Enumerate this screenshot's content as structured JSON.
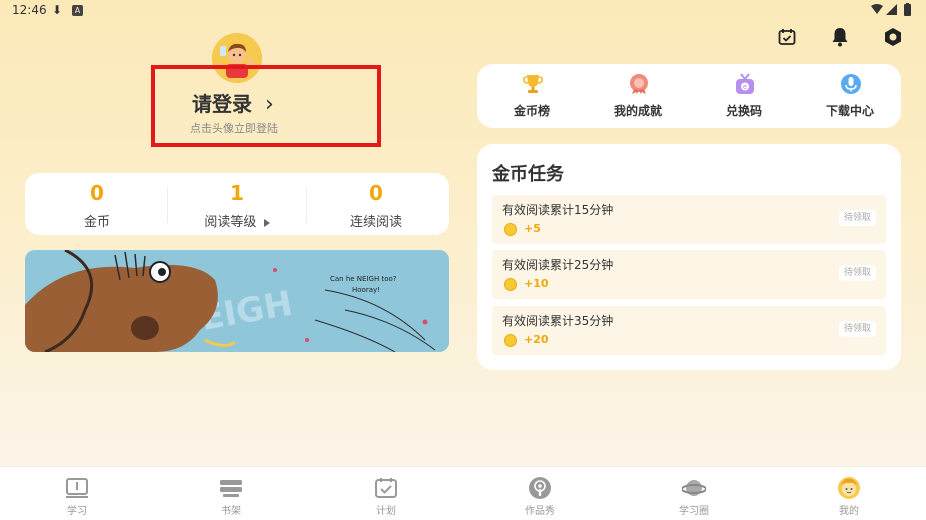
{
  "status_bar": {
    "time": "12:46",
    "download_glyph": "⬇",
    "a_badge": "A",
    "right_glyphs": "▾◢▮"
  },
  "top_icons": [
    {
      "name": "calendar-check-icon"
    },
    {
      "name": "bell-icon"
    },
    {
      "name": "settings-hex-icon"
    }
  ],
  "profile": {
    "login_title": "请登录",
    "chevron": "›",
    "login_subtitle": "点击头像立即登陆"
  },
  "stats": [
    {
      "value": "0",
      "label": "金币"
    },
    {
      "value": "1",
      "label": "阅读等级"
    },
    {
      "value": "0",
      "label": "连续阅读"
    }
  ],
  "banner": {
    "line1": "Can he NEIGH too?",
    "line2": "Hooray!",
    "big_text": "NEIGH"
  },
  "quick_links": [
    {
      "label": "金币榜",
      "icon": "trophy-icon"
    },
    {
      "label": "我的成就",
      "icon": "medal-icon"
    },
    {
      "label": "兑换码",
      "icon": "gift-code-icon"
    },
    {
      "label": "下载中心",
      "icon": "download-center-icon"
    }
  ],
  "tasks": {
    "title": "金币任务",
    "items": [
      {
        "name": "有效阅读累计15分钟",
        "reward": "+5",
        "button": "待领取"
      },
      {
        "name": "有效阅读累计25分钟",
        "reward": "+10",
        "button": "待领取"
      },
      {
        "name": "有效阅读累计35分钟",
        "reward": "+20",
        "button": "待领取"
      }
    ]
  },
  "bottom_nav": [
    {
      "label": "学习",
      "icon": "book-icon"
    },
    {
      "label": "书架",
      "icon": "bookshelf-icon"
    },
    {
      "label": "计划",
      "icon": "plan-calendar-icon"
    },
    {
      "label": "作品秀",
      "icon": "podcast-icon"
    },
    {
      "label": "学习圈",
      "icon": "planet-icon"
    },
    {
      "label": "我的",
      "icon": "profile-face-icon",
      "active": true
    }
  ],
  "colors": {
    "accent": "#f2a60e",
    "highlight_box": "#e41818",
    "background": "#fbe9b8"
  }
}
